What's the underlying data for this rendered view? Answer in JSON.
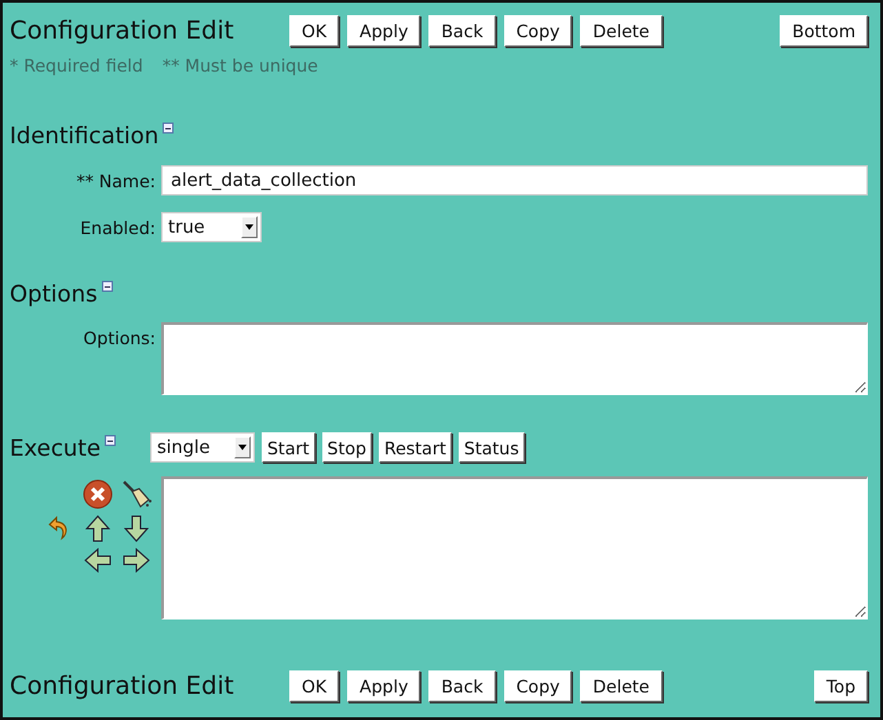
{
  "header": {
    "title": "Configuration Edit",
    "buttons": [
      "OK",
      "Apply",
      "Back",
      "Copy",
      "Delete"
    ],
    "jump_button": "Bottom"
  },
  "legend": [
    "* Required field",
    "** Must be unique"
  ],
  "sections": [
    {
      "title": "Identification",
      "expanded": true,
      "fields": [
        {
          "kind": "text",
          "label": "** Name:",
          "value": "alert_data_collection"
        },
        {
          "kind": "select",
          "label": "Enabled:",
          "value": "true"
        }
      ]
    },
    {
      "title": "Options",
      "expanded": true,
      "fields": [
        {
          "kind": "textarea",
          "label": "Options:"
        }
      ]
    },
    {
      "title": "Execute",
      "expanded": true,
      "controls": {
        "mode": "single",
        "buttons": [
          "Start",
          "Stop",
          "Restart",
          "Status"
        ]
      },
      "fields": [
        {
          "kind": "script_editor"
        }
      ]
    }
  ],
  "footer": {
    "title": "Configuration Edit",
    "buttons": [
      "OK",
      "Apply",
      "Back",
      "Copy",
      "Delete"
    ],
    "jump_button": "Top"
  }
}
